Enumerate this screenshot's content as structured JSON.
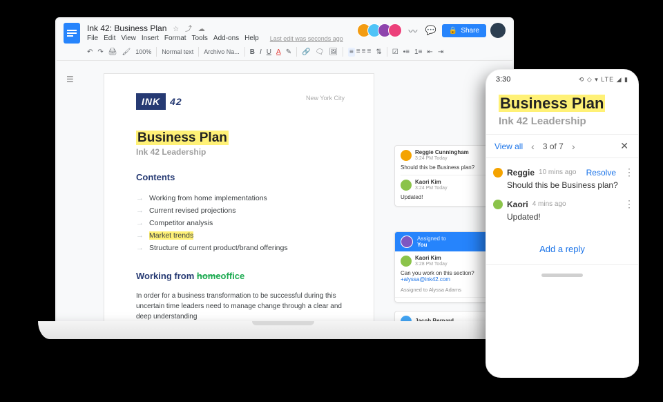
{
  "doc": {
    "title": "Ink 42: Business Plan",
    "menus": [
      "File",
      "Edit",
      "View",
      "Insert",
      "Format",
      "Tools",
      "Add-ons",
      "Help"
    ],
    "last_edit": "Last edit was seconds ago",
    "share_label": "Share",
    "toolbar": {
      "zoom": "100%",
      "style": "Normal text",
      "font": "Archivo Na..."
    },
    "page": {
      "brand_ink": "INK",
      "brand_num": "42",
      "location": "New York City",
      "title": "Business Plan",
      "subtitle": "Ink 42 Leadership",
      "contents_heading": "Contents",
      "toc": [
        "Working from home implementations",
        "Current revised projections",
        "Competitor analysis",
        "Market trends",
        "Structure of current product/brand offerings"
      ],
      "section2_pre": "Working from ",
      "section2_strike": "home",
      "section2_post": "office",
      "body": "In order for a business transformation to be successful during this uncertain time leaders need to manage change through a clear and deep understanding"
    },
    "comments": [
      {
        "name": "Reggie Cunningham",
        "time": "3:24 PM Today",
        "text": "Should this be Business plan?"
      },
      {
        "name": "Kaori Kim",
        "time": "3:24 PM Today",
        "text": "Updated!"
      }
    ],
    "assignment": {
      "assigned_label": "Assigned to",
      "assignee_self": "You",
      "author": "Kaori Kim",
      "time": "3:28 PM Today",
      "text": "Can you work on this section?",
      "mention": "+alyssa@ink42.com",
      "assigned_to_line": "Assigned to Alyssa Adams",
      "next_name": "Jacob Bernard"
    }
  },
  "phone": {
    "time": "3:30",
    "status": "⟲ ◇ ▾ LTE ◢ ▮",
    "title": "Business Plan",
    "subtitle": "Ink 42 Leadership",
    "view_all": "View all",
    "counter_pre": "3 of 7",
    "comments": [
      {
        "name": "Reggie",
        "time": "10 mins ago",
        "text": "Should this be Business plan?",
        "action": "Resolve"
      },
      {
        "name": "Kaori",
        "time": "4 mins ago",
        "text": "Updated!"
      }
    ],
    "add_reply": "Add a reply"
  }
}
